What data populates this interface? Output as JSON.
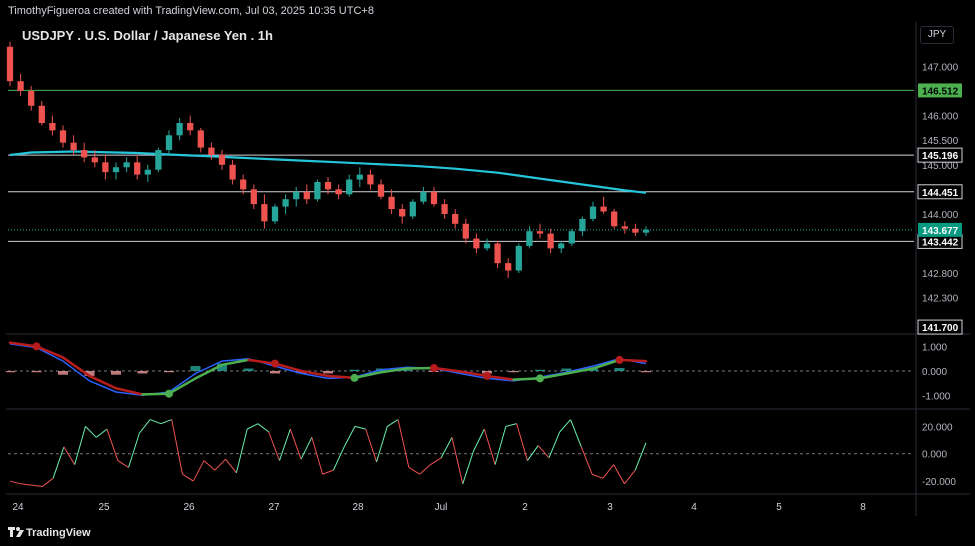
{
  "header": {
    "attribution": "TimothyFigueroa created with TradingView.com, Jul 03, 2025 10:35 UTC+8",
    "symbol_title": "USDJPY . U.S. Dollar / Japanese Yen . 1h",
    "currency": "JPY"
  },
  "footer": {
    "brand": "TradingView"
  },
  "colors": {
    "up": "#26a69a",
    "down": "#ef5350",
    "ma": "#26c6da",
    "green_level": "#4caf50",
    "macd_fast": "#2962ff",
    "macd_red": "#b71c1c",
    "macd_green": "#4caf50",
    "osc_up": "#69f0ae",
    "osc_down": "#ef5350"
  },
  "chart_data": [
    {
      "type": "candlestick",
      "title": "USDJPY . U.S. Dollar / Japanese Yen . 1h",
      "x_labels": [
        "24",
        "25",
        "26",
        "27",
        "28",
        "Jul",
        "2",
        "3",
        "4",
        "5",
        "8"
      ],
      "y_ticks": [
        "147.000",
        "146.000",
        "145.500",
        "145.000",
        "144.000",
        "142.800",
        "142.300"
      ],
      "ylim": [
        141.6,
        147.7
      ],
      "candles": [
        [
          147.4,
          147.5,
          146.6,
          146.7
        ],
        [
          146.7,
          146.85,
          146.4,
          146.5
        ],
        [
          146.5,
          146.6,
          146.1,
          146.2
        ],
        [
          146.2,
          146.3,
          145.8,
          145.85
        ],
        [
          145.85,
          146.0,
          145.6,
          145.7
        ],
        [
          145.7,
          145.8,
          145.35,
          145.45
        ],
        [
          145.45,
          145.6,
          145.2,
          145.3
        ],
        [
          145.3,
          145.45,
          145.05,
          145.15
        ],
        [
          145.15,
          145.3,
          144.95,
          145.05
        ],
        [
          145.05,
          145.2,
          144.7,
          144.85
        ],
        [
          144.85,
          145.05,
          144.7,
          144.95
        ],
        [
          144.95,
          145.15,
          144.85,
          145.05
        ],
        [
          145.05,
          145.2,
          144.7,
          144.8
        ],
        [
          144.8,
          145.0,
          144.65,
          144.9
        ],
        [
          144.9,
          145.35,
          144.85,
          145.3
        ],
        [
          145.3,
          145.7,
          145.2,
          145.6
        ],
        [
          145.6,
          145.95,
          145.5,
          145.85
        ],
        [
          145.85,
          146.0,
          145.6,
          145.7
        ],
        [
          145.7,
          145.75,
          145.25,
          145.35
        ],
        [
          145.35,
          145.45,
          145.1,
          145.2
        ],
        [
          145.2,
          145.3,
          144.9,
          145.0
        ],
        [
          145.0,
          145.1,
          144.6,
          144.7
        ],
        [
          144.7,
          144.8,
          144.4,
          144.5
        ],
        [
          144.5,
          144.6,
          144.1,
          144.2
        ],
        [
          144.2,
          144.4,
          143.7,
          143.85
        ],
        [
          143.85,
          144.2,
          143.8,
          144.15
        ],
        [
          144.15,
          144.4,
          144.0,
          144.3
        ],
        [
          144.3,
          144.55,
          144.15,
          144.45
        ],
        [
          144.45,
          144.6,
          144.2,
          144.3
        ],
        [
          144.3,
          144.7,
          144.25,
          144.65
        ],
        [
          144.65,
          144.75,
          144.4,
          144.5
        ],
        [
          144.5,
          144.6,
          144.3,
          144.4
        ],
        [
          144.4,
          144.8,
          144.35,
          144.7
        ],
        [
          144.7,
          144.95,
          144.55,
          144.8
        ],
        [
          144.8,
          144.9,
          144.5,
          144.6
        ],
        [
          144.6,
          144.7,
          144.3,
          144.35
        ],
        [
          144.35,
          144.5,
          144.0,
          144.1
        ],
        [
          144.1,
          144.2,
          143.8,
          143.95
        ],
        [
          143.95,
          144.3,
          143.9,
          144.25
        ],
        [
          144.25,
          144.55,
          144.2,
          144.45
        ],
        [
          144.45,
          144.55,
          144.15,
          144.2
        ],
        [
          144.2,
          144.3,
          143.9,
          144.0
        ],
        [
          144.0,
          144.1,
          143.7,
          143.8
        ],
        [
          143.8,
          143.9,
          143.4,
          143.5
        ],
        [
          143.5,
          143.6,
          143.2,
          143.3
        ],
        [
          143.3,
          143.5,
          143.25,
          143.4
        ],
        [
          143.4,
          143.45,
          142.9,
          143.0
        ],
        [
          143.0,
          143.1,
          142.7,
          142.85
        ],
        [
          142.85,
          143.4,
          142.8,
          143.35
        ],
        [
          143.35,
          143.75,
          143.3,
          143.65
        ],
        [
          143.65,
          143.8,
          143.5,
          143.6
        ],
        [
          143.6,
          143.7,
          143.2,
          143.3
        ],
        [
          143.3,
          143.45,
          143.2,
          143.4
        ],
        [
          143.4,
          143.7,
          143.35,
          143.65
        ],
        [
          143.65,
          143.95,
          143.55,
          143.9
        ],
        [
          143.9,
          144.25,
          143.85,
          144.15
        ],
        [
          144.15,
          144.35,
          144.0,
          144.05
        ],
        [
          144.05,
          144.1,
          143.7,
          143.75
        ],
        [
          143.75,
          143.85,
          143.6,
          143.7
        ],
        [
          143.7,
          143.8,
          143.55,
          143.62
        ],
        [
          143.62,
          143.75,
          143.55,
          143.68
        ]
      ],
      "ma_line": [
        145.2,
        145.25,
        145.26,
        145.27,
        145.26,
        145.25,
        145.24,
        145.22,
        145.2,
        145.18,
        145.16,
        145.14,
        145.12,
        145.1,
        145.08,
        145.06,
        145.04,
        145.02,
        145.0,
        144.98,
        144.95,
        144.92,
        144.88,
        144.84,
        144.78,
        144.72,
        144.66,
        144.6,
        144.54,
        144.48,
        144.43
      ],
      "horizontal_levels": [
        {
          "value": 146.512,
          "label": "146.512",
          "color": "#4caf50"
        },
        {
          "value": 145.196,
          "label": "145.196",
          "color": "#d1d4dc"
        },
        {
          "value": 144.451,
          "label": "144.451",
          "color": "#d1d4dc"
        },
        {
          "value": 143.442,
          "label": "143.442",
          "color": "#d1d4dc"
        },
        {
          "value": 141.7,
          "label": "141.700",
          "color": "#d1d4dc"
        }
      ],
      "last_price": {
        "value": 143.677,
        "label": "143.677"
      }
    },
    {
      "type": "line",
      "y_ticks": [
        "1.000",
        "0.000",
        "-1.000"
      ],
      "ylim": [
        -1.5,
        1.5
      ],
      "fast_line": [
        1.1,
        0.95,
        0.4,
        -0.4,
        -0.85,
        -0.98,
        -0.85,
        -0.1,
        0.4,
        0.5,
        0.2,
        -0.1,
        -0.3,
        -0.25,
        0.05,
        0.15,
        0.1,
        -0.1,
        -0.3,
        -0.4,
        -0.25,
        -0.05,
        0.2,
        0.5,
        0.3
      ],
      "slow_line": [
        1.15,
        1.0,
        0.55,
        -0.2,
        -0.7,
        -0.95,
        -0.92,
        -0.3,
        0.25,
        0.45,
        0.3,
        0.0,
        -0.2,
        -0.28,
        -0.05,
        0.1,
        0.12,
        -0.02,
        -0.2,
        -0.35,
        -0.3,
        -0.1,
        0.1,
        0.45,
        0.4
      ],
      "histogram": [
        -0.05,
        -0.05,
        -0.15,
        -0.2,
        -0.15,
        -0.1,
        -0.05,
        0.2,
        0.3,
        0.1,
        -0.1,
        -0.1,
        -0.1,
        0.05,
        0.1,
        0.05,
        -0.02,
        -0.08,
        -0.1,
        -0.05,
        0.05,
        0.1,
        0.15,
        0.12,
        -0.05
      ],
      "cross_points": [
        {
          "i": 1,
          "kind": "down"
        },
        {
          "i": 6,
          "kind": "up"
        },
        {
          "i": 10,
          "kind": "down"
        },
        {
          "i": 13,
          "kind": "up"
        },
        {
          "i": 16,
          "kind": "down"
        },
        {
          "i": 18,
          "kind": "down"
        },
        {
          "i": 20,
          "kind": "up"
        },
        {
          "i": 23,
          "kind": "down"
        }
      ]
    },
    {
      "type": "line",
      "y_ticks": [
        "20.000",
        "0.000",
        "-20.000"
      ],
      "ylim": [
        -28,
        32
      ],
      "values": [
        -20,
        -22,
        -23,
        -24,
        -18,
        5,
        -8,
        20,
        12,
        18,
        -5,
        -10,
        15,
        25,
        22,
        25,
        -15,
        -20,
        -5,
        -12,
        -4,
        -14,
        18,
        22,
        16,
        -5,
        18,
        -4,
        12,
        -15,
        -12,
        5,
        20,
        18,
        -6,
        20,
        25,
        -10,
        -15,
        -8,
        -3,
        12,
        -22,
        2,
        18,
        -8,
        20,
        22,
        -5,
        6,
        -3,
        16,
        25,
        5,
        -15,
        -18,
        -8,
        -22,
        -12,
        8
      ]
    }
  ]
}
